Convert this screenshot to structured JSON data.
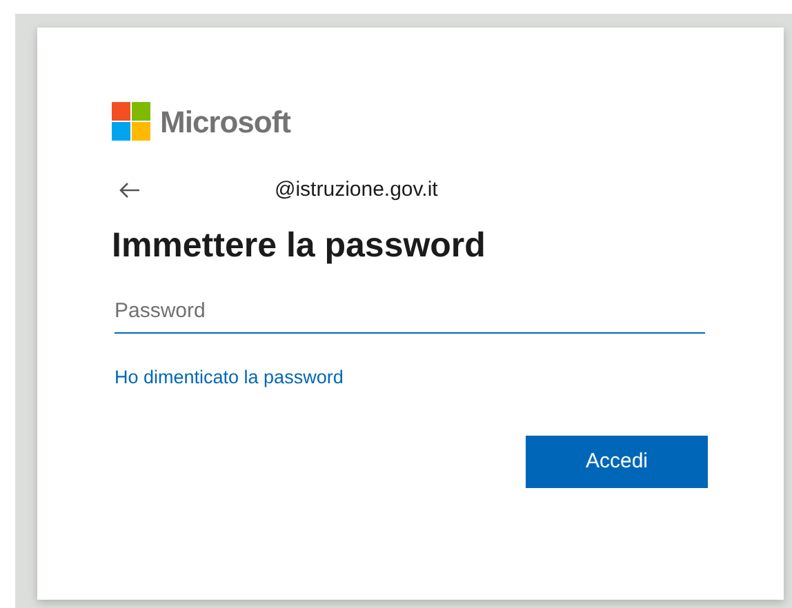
{
  "logo": {
    "text": "Microsoft"
  },
  "identity": {
    "email": "@istruzione.gov.it"
  },
  "heading": "Immettere la password",
  "password_field": {
    "placeholder": "Password"
  },
  "forgot_link": "Ho dimenticato la password",
  "buttons": [
    "Accedi"
  ]
}
